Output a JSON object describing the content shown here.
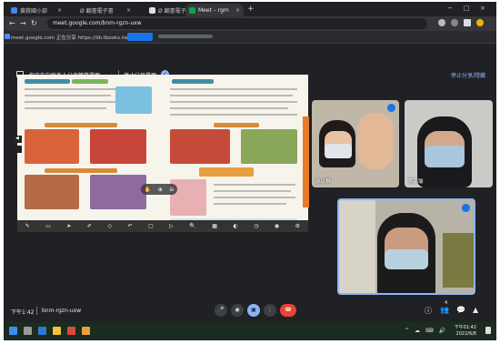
{
  "browser": {
    "tabs": [
      {
        "label": "搶救國小部",
        "fav_color": "#4285f4",
        "active": false
      },
      {
        "label": "Ø 翻書電子書",
        "fav_color": "#888888",
        "active": false
      },
      {
        "label": "Ø 翻書電子書",
        "fav_color": "#e0e0e0",
        "active": false
      },
      {
        "label": "Meet – rgm",
        "fav_color": "#00ac47",
        "active": true
      }
    ],
    "window_controls": [
      "−",
      "□",
      "×"
    ],
    "new_tab": "+",
    "address": "meet.google.com/bnm-rgzn-uxw",
    "infobar_text": "meet.google.com 正在分享 https://lib.tbooks.tw"
  },
  "share_bar": {
    "presenting_label": "你正在向所有人分享螢幕畫面",
    "stop_label": "停止分享畫面",
    "right_label": "停止分享/隱藏"
  },
  "participants": [
    {
      "name": "廖以桐",
      "id": "p1"
    },
    {
      "name": "吳宸瑜",
      "id": "p2"
    },
    {
      "name": "",
      "id": "p3"
    }
  ],
  "bottom_bar": {
    "time": "下午1:42",
    "meeting_code": "bnm-rgzn-uxw",
    "controls": [
      {
        "name": "mic",
        "glyph": "🎤"
      },
      {
        "name": "camera",
        "glyph": "◉"
      },
      {
        "name": "present",
        "glyph": "▣"
      },
      {
        "name": "more",
        "glyph": "⋮"
      },
      {
        "name": "end-call",
        "glyph": "☎"
      }
    ],
    "right_controls": [
      "ⓘ",
      "👥",
      "💬",
      "▲"
    ],
    "participant_count": "4"
  },
  "taskbar": {
    "clock_time": "下午01:42",
    "clock_date": "2022/6/8",
    "tray": "^ ☁ ⌨ 🔊"
  },
  "colors": {
    "meet_bg": "#202124",
    "accent": "#8ab4f8",
    "end_call": "#ea4335",
    "textbook_tab": "#e97a2a"
  }
}
